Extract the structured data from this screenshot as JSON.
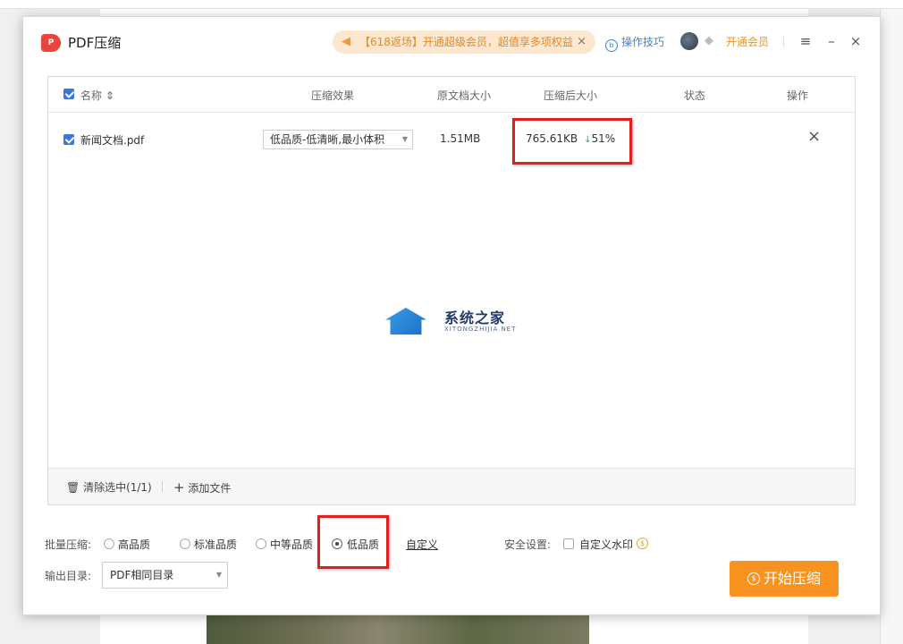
{
  "app": {
    "title": "PDF压缩",
    "logo_text": "P"
  },
  "promo": {
    "text": "【618返场】开通超级会员，超值享多项权益",
    "close": "×"
  },
  "header": {
    "tips": "操作技巧",
    "tips_icon_glyph": "b",
    "vip": "开通会员"
  },
  "window_controls": {
    "menu": "≡",
    "minimize": "–",
    "close": "×"
  },
  "table": {
    "columns": {
      "name": "名称 ⇕",
      "effect": "压缩效果",
      "original": "原文档大小",
      "compressed": "压缩后大小",
      "status": "状态",
      "action": "操作"
    },
    "rows": [
      {
        "filename": "新闻文档.pdf",
        "effect": "低品质-低清晰,最小体积",
        "original_size": "1.51MB",
        "compressed_size": "765.61KB",
        "reduction": "51%",
        "status": "",
        "remove": "×"
      }
    ],
    "footer": {
      "clear": "清除选中(1/1)",
      "add": "添加文件"
    }
  },
  "watermark": {
    "title": "系统之家",
    "subtitle": "XITONGZHIJIA.NET"
  },
  "batch": {
    "label": "批量压缩:",
    "options": [
      "高品质",
      "标准品质",
      "中等品质",
      "低品质"
    ],
    "selected": "低品质",
    "custom": "自定义"
  },
  "security": {
    "label": "安全设置:",
    "watermark_option": "自定义水印",
    "coin_glyph": "$"
  },
  "output": {
    "label": "输出目录:",
    "value": "PDF相同目录"
  },
  "start_button": {
    "label": "开始压缩",
    "icon_glyph": "$"
  },
  "colors": {
    "accent": "#3a77d6",
    "orange": "#f7931e",
    "highlight": "#e02020"
  }
}
